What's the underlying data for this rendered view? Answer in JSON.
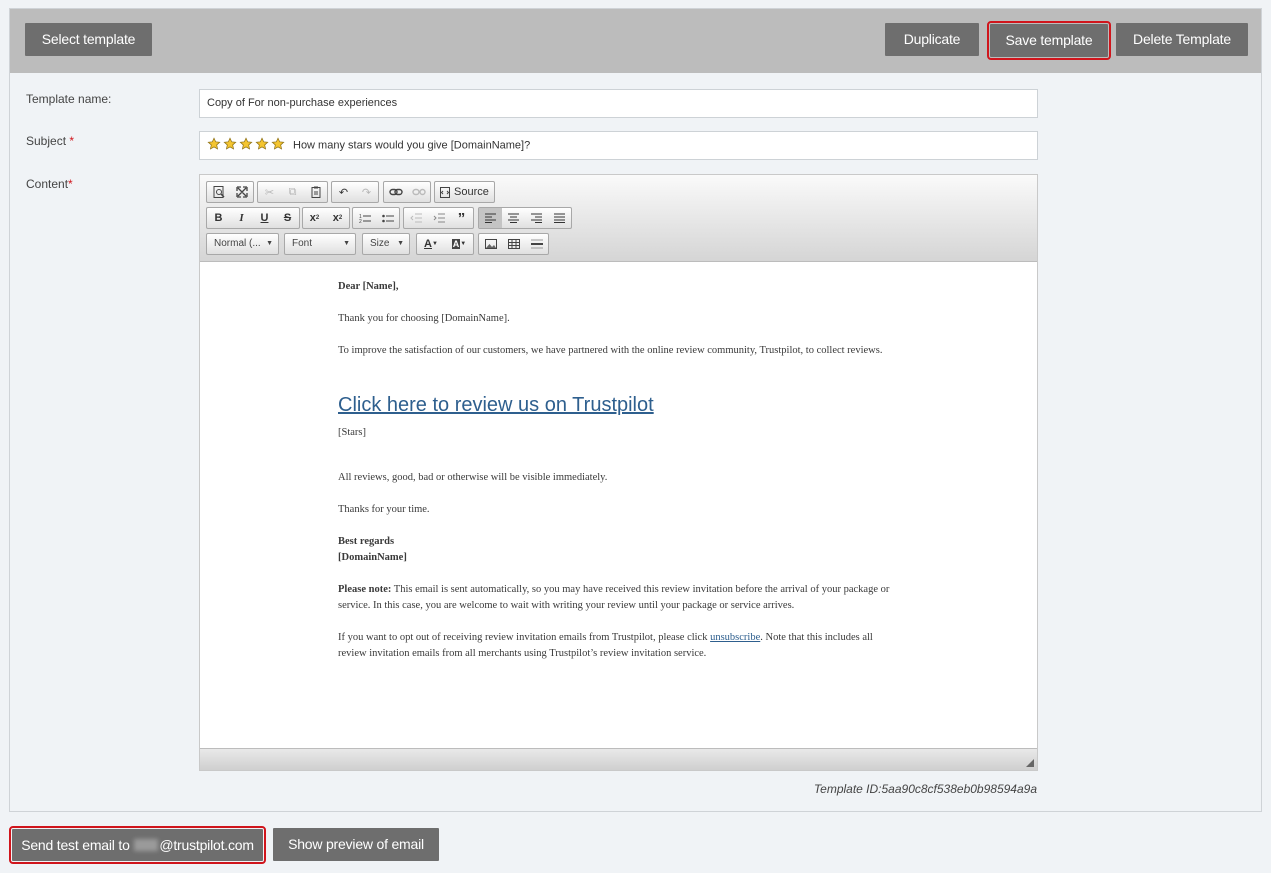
{
  "toolbar": {
    "select_template": "Select template",
    "duplicate": "Duplicate",
    "save_template": "Save template",
    "delete_template": "Delete Template"
  },
  "form": {
    "template_name_label": "Template name:",
    "template_name_value": "Copy of For non-purchase experiences",
    "subject_label": "Subject",
    "subject_stars": 5,
    "subject_value": "How many stars would you give [DomainName]?",
    "content_label": "Content",
    "required_mark": "*"
  },
  "editor": {
    "source_label": "Source",
    "format_combo": "Normal (...",
    "font_combo": "Font",
    "size_combo": "Size",
    "icons": [
      "preview-icon",
      "maximize-icon",
      "cut-icon",
      "copy-icon",
      "paste-icon",
      "undo-icon",
      "redo-icon",
      "link-icon",
      "unlink-icon",
      "source-icon",
      "bold-icon",
      "italic-icon",
      "underline-icon",
      "strike-icon",
      "subscript-icon",
      "superscript-icon",
      "numbered-list-icon",
      "bullet-list-icon",
      "outdent-icon",
      "indent-icon",
      "blockquote-icon",
      "align-left-icon",
      "align-center-icon",
      "align-right-icon",
      "justify-icon",
      "text-color-icon",
      "bg-color-icon",
      "image-icon",
      "table-icon",
      "horizontal-rule-icon",
      "resize-grip-icon"
    ],
    "body": {
      "greeting": "Dear [Name],",
      "thanks_line": "Thank you for choosing [DomainName].",
      "intro": "To improve the satisfaction of our customers, we have partnered with the online review community, Trustpilot, to collect reviews.",
      "cta_link": "Click here to review us on Trustpilot",
      "stars_placeholder": "[Stars]",
      "visibility_line": "All reviews, good, bad or otherwise will be visible immediately.",
      "thanks_time": "Thanks for your time.",
      "signoff": "Best regards",
      "signoff_domain": "[DomainName]",
      "note_label": "Please note:",
      "note_text": " This email is sent automatically, so you may have received this review invitation before the arrival of your package or service. In this case, you are welcome to wait with writing your review until your package or service arrives.",
      "optout_before": "If you want to opt out of receiving review invitation emails from Trustpilot, please click ",
      "optout_link": "unsubscribe",
      "optout_after": ". Note that this includes all review invitation emails from all merchants using Trustpilot’s review invitation service."
    }
  },
  "template_id": "Template ID:5aa90c8cf538eb0b98594a9a",
  "footer": {
    "send_test_prefix": "Send test email to ",
    "send_test_domain": "@trustpilot.com",
    "show_preview": "Show preview of email"
  },
  "colors": {
    "button_bg": "#6e6e6e",
    "highlight": "#d0151c",
    "link": "#2e5f8e",
    "star": "#f4c531"
  }
}
